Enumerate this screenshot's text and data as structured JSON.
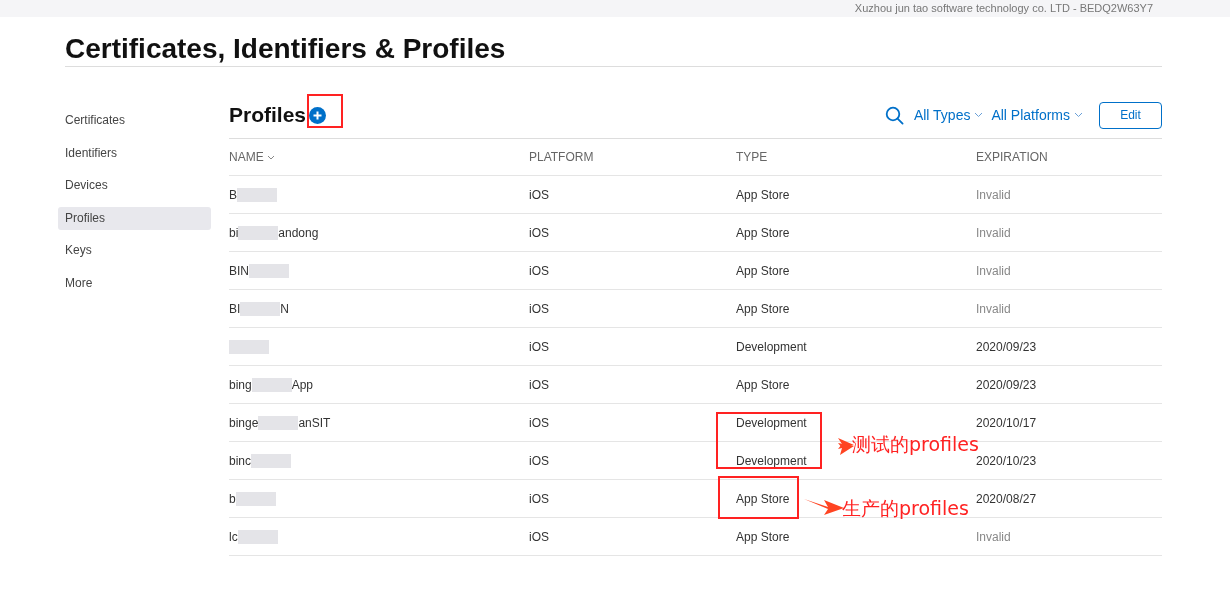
{
  "top_bar": {
    "team": "Xuzhou jun tao software technology co. LTD - BEDQ2W63Y7"
  },
  "title": "Certificates, Identifiers & Profiles",
  "sidebar": {
    "items": [
      {
        "label": "Certificates",
        "selected": false
      },
      {
        "label": "Identifiers",
        "selected": false
      },
      {
        "label": "Devices",
        "selected": false
      },
      {
        "label": "Profiles",
        "selected": true
      },
      {
        "label": "Keys",
        "selected": false
      },
      {
        "label": "More",
        "selected": false
      }
    ]
  },
  "heading": "Profiles",
  "filters": [
    "All Types",
    "All Platforms"
  ],
  "edit_button": "Edit",
  "table": {
    "columns": [
      "NAME",
      "PLATFORM",
      "TYPE",
      "EXPIRATION"
    ],
    "rows": [
      {
        "name_start": "B",
        "platform": "iOS",
        "type": "App Store",
        "expiration": "Invalid",
        "expired": true
      },
      {
        "name_start": "bi",
        "name_end": "andong",
        "platform": "iOS",
        "type": "App Store",
        "expiration": "Invalid",
        "expired": true
      },
      {
        "name_start": "BIN",
        "platform": "iOS",
        "type": "App Store",
        "expiration": "Invalid",
        "expired": true
      },
      {
        "name_start": "BI",
        "name_end": "N",
        "platform": "iOS",
        "type": "App Store",
        "expiration": "Invalid",
        "expired": true
      },
      {
        "platform": "iOS",
        "type": "Development",
        "expiration": "2020/09/23",
        "expired": false
      },
      {
        "name_start": "bing",
        "name_end": "App",
        "platform": "iOS",
        "type": "App Store",
        "expiration": "2020/09/23",
        "expired": false
      },
      {
        "name_start": "binge",
        "name_end": "anSIT",
        "platform": "iOS",
        "type": "Development",
        "expiration": "2020/10/17",
        "expired": false
      },
      {
        "name_start": "binc",
        "platform": "iOS",
        "type": "Development",
        "expiration": "2020/10/23",
        "expired": false
      },
      {
        "name_start": "b",
        "platform": "iOS",
        "type": "App Store",
        "expiration": "2020/08/27",
        "expired": false
      },
      {
        "name_start": "lc",
        "platform": "iOS",
        "type": "App Store",
        "expiration": "Invalid",
        "expired": true
      }
    ]
  },
  "annotations": [
    {
      "label": "测试的profiles"
    },
    {
      "label": "生产的profiles"
    }
  ]
}
